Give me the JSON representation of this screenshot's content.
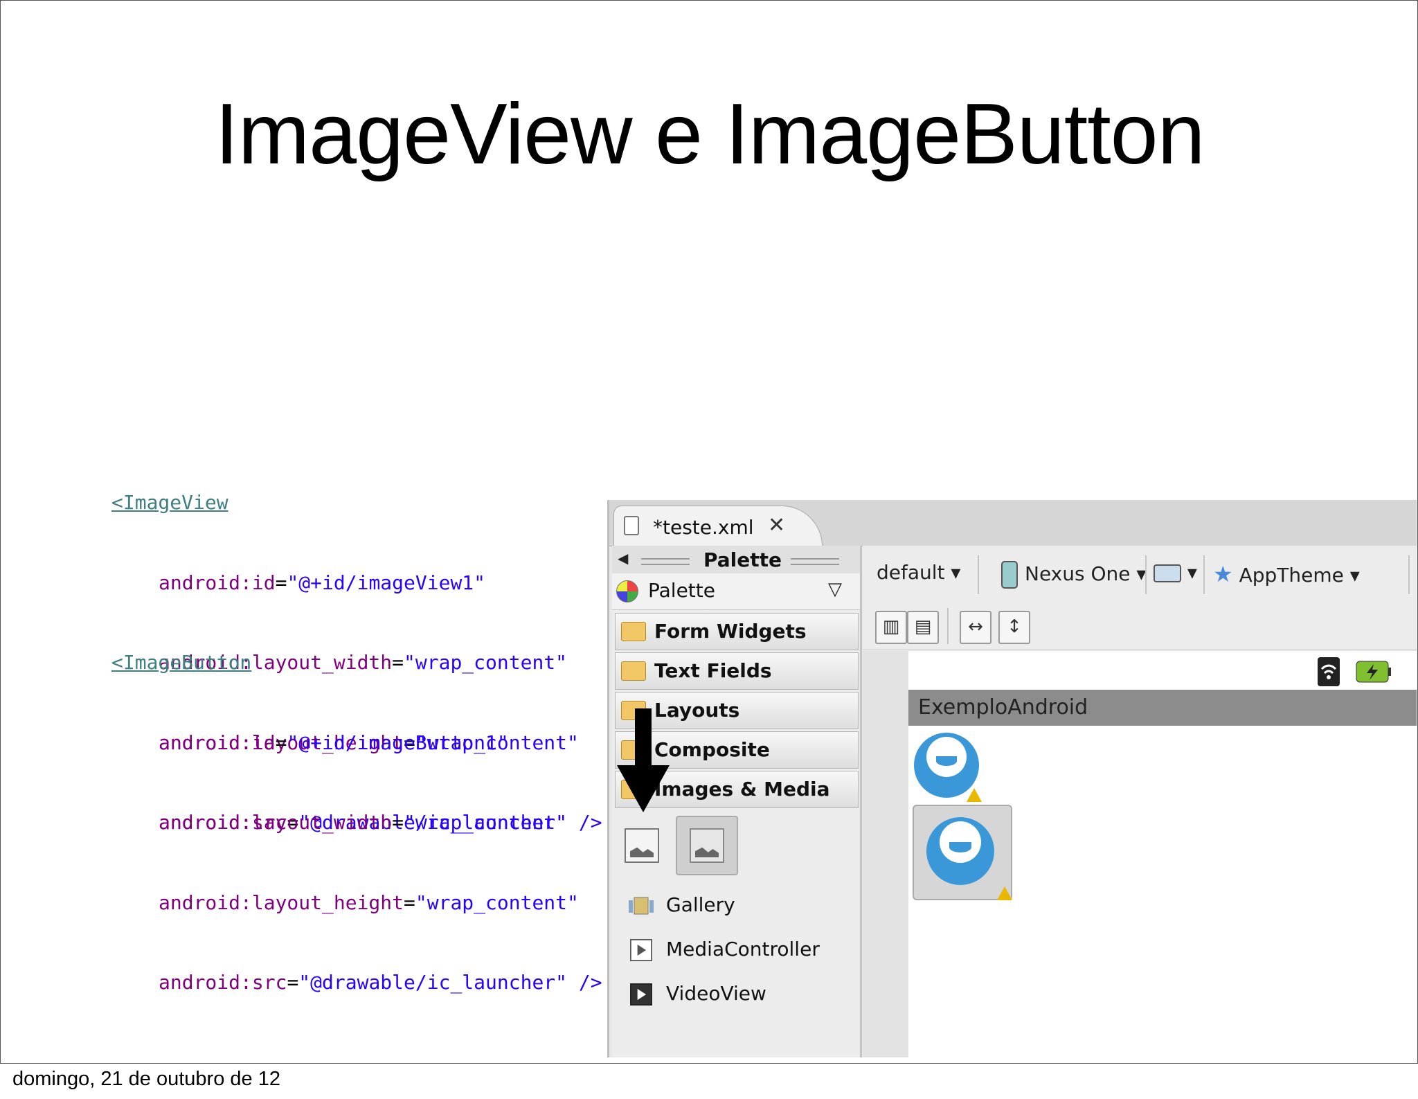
{
  "slide": {
    "title": "ImageView e ImageButton",
    "footer": "domingo, 21 de outubro de 12"
  },
  "code": {
    "image_view": {
      "tag": "<ImageView",
      "lines": [
        {
          "attr": "android:id",
          "eq": "=",
          "val": "\"@+id/imageView1\""
        },
        {
          "attr": "android:layout_width",
          "eq": "=",
          "val": "\"wrap_content\""
        },
        {
          "attr": "android:layout_height",
          "eq": "=",
          "val": "\"wrap_content\""
        },
        {
          "attr": "android:src",
          "eq": "=",
          "val": "\"@drawable/ic_launcher\" />"
        }
      ]
    },
    "image_button": {
      "tag": "<ImageButton",
      "lines": [
        {
          "attr": "android:id",
          "eq": "=",
          "val": "\"@+id/imageButton1\""
        },
        {
          "attr": "android:layout_width",
          "eq": "=",
          "val": "\"wrap_content\""
        },
        {
          "attr": "android:layout_height",
          "eq": "=",
          "val": "\"wrap_content\""
        },
        {
          "attr": "android:src",
          "eq": "=",
          "val": "\"@drawable/ic_launcher\" />"
        }
      ]
    }
  },
  "ide": {
    "tab": {
      "label": "*teste.xml",
      "close": "✕"
    },
    "palette": {
      "header": "Palette",
      "selector": "Palette",
      "categories": [
        "Form Widgets",
        "Text Fields",
        "Layouts",
        "Composite",
        "Images & Media"
      ],
      "items": [
        "Gallery",
        "MediaController",
        "VideoView"
      ]
    },
    "toolbar": {
      "config": "default",
      "device": "Nexus One",
      "theme": "AppTheme"
    },
    "preview": {
      "app_title": "ExemploAndroid"
    }
  },
  "colors": {
    "tag": "#3f7f7f",
    "attr": "#7f007f",
    "value": "#2a00ff",
    "launcher_blue": "#3a98d8",
    "action_bar": "#8c8c8c"
  }
}
